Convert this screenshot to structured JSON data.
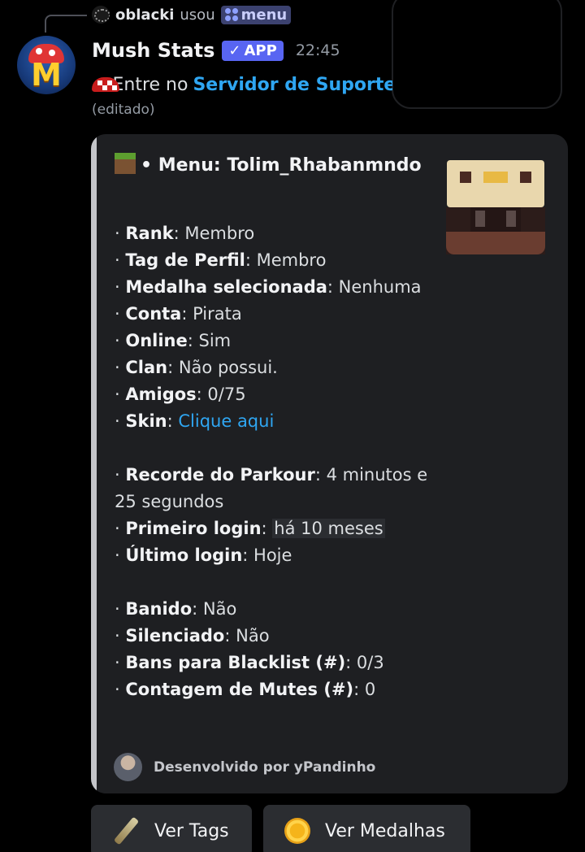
{
  "reply": {
    "user": "oblacki",
    "verb": "usou",
    "command": "menu"
  },
  "message": {
    "bot_name": "Mush Stats",
    "app_tag": "APP",
    "app_check": "✓",
    "timestamp": "22:45",
    "prefix": "»",
    "text_before": "Entre no",
    "link_text": "Servidor de Suporte",
    "edited": "(editado)",
    "emoji": "mushroom-emoji"
  },
  "embed": {
    "title": "• Menu: Tolim_Rhabanmndo",
    "fields": {
      "rank_label": "Rank",
      "rank_value": ": Membro",
      "tag_label": "Tag de Perfil",
      "tag_value": ": Membro",
      "medal_label": "Medalha selecionada",
      "medal_value": ": Nenhuma",
      "account_label": "Conta",
      "account_value": ": Pirata",
      "online_label": "Online",
      "online_value": ": Sim",
      "clan_label": "Clan",
      "clan_value": ": Não possui.",
      "friends_label": "Amigos",
      "friends_value": ": 0/75",
      "skin_label": "Skin",
      "skin_colon": ": ",
      "skin_link": "Clique aqui",
      "parkour_label": "Recorde do Parkour",
      "parkour_value": ": 4 minutos e 25 segundos",
      "first_login_label": "Primeiro login",
      "first_login_colon": ": ",
      "first_login_value": "há 10 meses",
      "last_login_label": "Último login",
      "last_login_value": ": Hoje",
      "banned_label": "Banido",
      "banned_value": ": Não",
      "muted_label": "Silenciado",
      "muted_value": ": Não",
      "blacklist_label": "Bans para Blacklist (#)",
      "blacklist_value": ": 0/3",
      "mutes_label": "Contagem de Mutes (#)",
      "mutes_value": ": 0"
    },
    "footer": "Desenvolvido por yPandinho",
    "accent_color": "#c4c5c9"
  },
  "buttons": {
    "tags_label": "Ver Tags",
    "medals_label": "Ver Medalhas"
  },
  "colors": {
    "background": "#000000",
    "embed_bg": "#1e1f22",
    "link": "#2fa6f2",
    "app_tag": "#5865f2",
    "button_bg": "#2b2d31"
  }
}
